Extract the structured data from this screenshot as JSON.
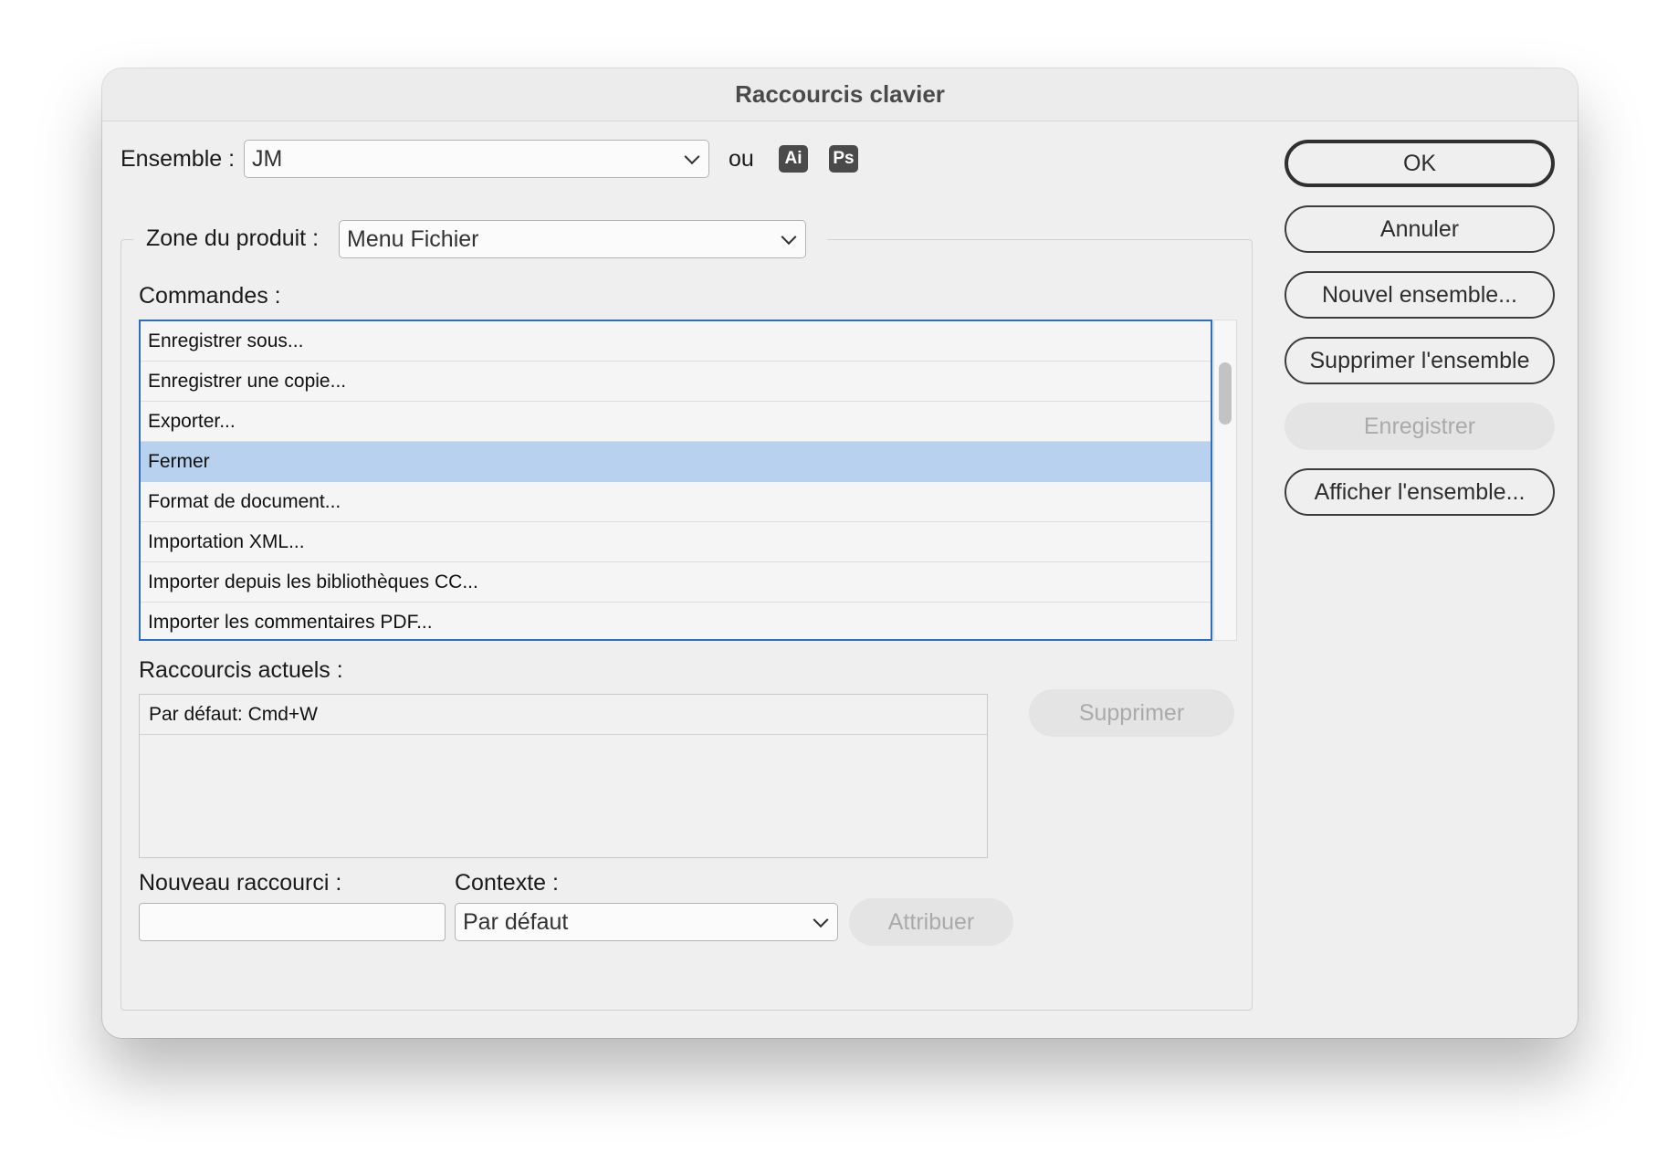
{
  "window": {
    "title": "Raccourcis clavier"
  },
  "ensemble": {
    "label": "Ensemble :",
    "value": "JM",
    "or_label": "ou",
    "app_badges": [
      "Ai",
      "Ps"
    ]
  },
  "zone": {
    "label": "Zone du produit :",
    "value": "Menu Fichier"
  },
  "commands": {
    "label": "Commandes :",
    "items": [
      "Enregistrer sous...",
      "Enregistrer une copie...",
      "Exporter...",
      "Fermer",
      "Format de document...",
      "Importation XML...",
      "Importer depuis les bibliothèques CC...",
      "Importer les commentaires PDF..."
    ],
    "selected_index": 3
  },
  "current_shortcuts": {
    "label": "Raccourcis actuels :",
    "items": [
      "Par défaut: Cmd+W"
    ],
    "delete_label": "Supprimer"
  },
  "new_shortcut": {
    "label": "Nouveau raccourci :",
    "value": ""
  },
  "context": {
    "label": "Contexte :",
    "value": "Par défaut",
    "assign_label": "Attribuer"
  },
  "buttons": {
    "ok": "OK",
    "cancel": "Annuler",
    "new_set": "Nouvel ensemble...",
    "delete_set": "Supprimer l'ensemble",
    "save": "Enregistrer",
    "show_set": "Afficher l'ensemble..."
  },
  "colors": {
    "selection": "#b7d1ee",
    "focus_ring": "#2a6fc4"
  }
}
